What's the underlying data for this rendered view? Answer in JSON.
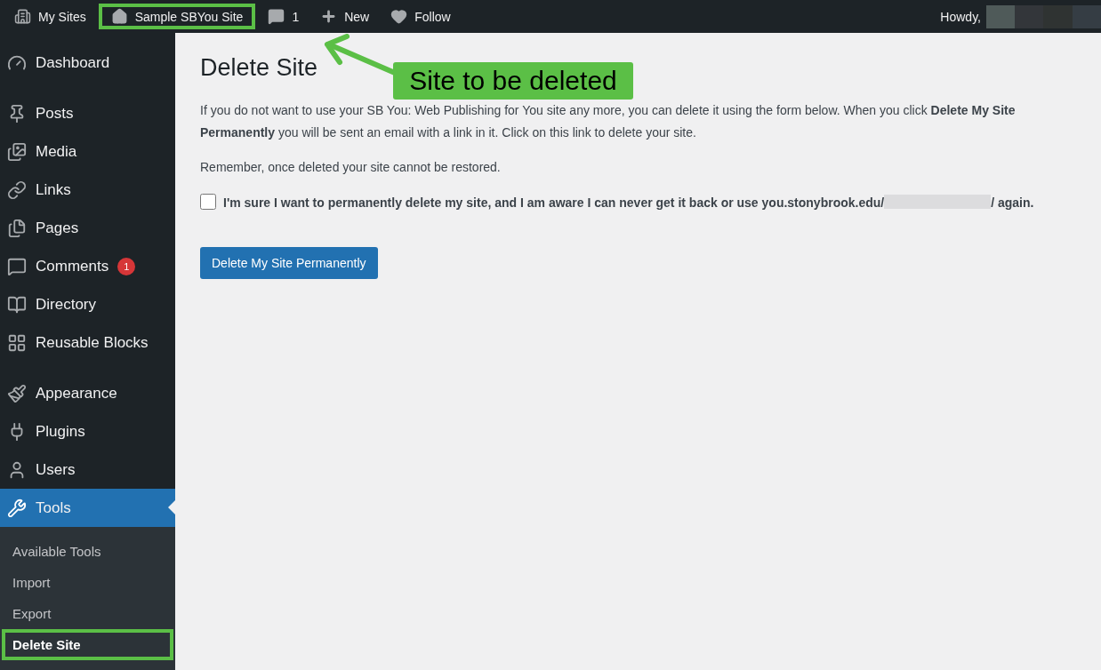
{
  "admin_bar": {
    "items": [
      {
        "kind": "sites",
        "label": "My Sites",
        "highlighted": false
      },
      {
        "kind": "home",
        "label": "Sample SBYou Site",
        "highlighted": true
      },
      {
        "kind": "comments",
        "label": "1",
        "highlighted": false
      },
      {
        "kind": "new",
        "label": "New",
        "highlighted": false
      },
      {
        "kind": "follow",
        "label": "Follow",
        "highlighted": false
      }
    ],
    "greeting": "Howdy,"
  },
  "sidebar": {
    "groups": [
      [
        {
          "label": "Dashboard",
          "selected": false
        }
      ],
      [
        {
          "label": "Posts",
          "selected": false
        },
        {
          "label": "Media",
          "selected": false
        },
        {
          "label": "Links",
          "selected": false
        },
        {
          "label": "Pages",
          "selected": false
        },
        {
          "label": "Comments",
          "selected": false,
          "badge": "1"
        },
        {
          "label": "Directory",
          "selected": false
        },
        {
          "label": "Reusable Blocks",
          "selected": false
        }
      ],
      [
        {
          "label": "Appearance",
          "selected": false
        },
        {
          "label": "Plugins",
          "selected": false
        },
        {
          "label": "Users",
          "selected": false
        },
        {
          "label": "Tools",
          "selected": true
        }
      ]
    ],
    "submenu": [
      {
        "label": "Available Tools",
        "selected": false,
        "highlighted": false
      },
      {
        "label": "Import",
        "selected": false,
        "highlighted": false
      },
      {
        "label": "Export",
        "selected": false,
        "highlighted": false
      },
      {
        "label": "Delete Site",
        "selected": true,
        "highlighted": true
      }
    ]
  },
  "main": {
    "title": "Delete Site",
    "paragraphs": [
      "If you do not want to use your SB You: Web Publishing for You site any more, you can delete it using the form below. When you click **Delete My Site Permanently** you will be sent an email with a link in it. Click on this link to delete your site.",
      "Remember, once deleted your site cannot be restored."
    ],
    "confirm": {
      "checked": false,
      "label_start": "I'm sure I want to permanently delete my site, and I am aware I can never get it back or use you.stonybrook.edu/",
      "label_end": "/ again."
    },
    "button": "Delete My Site Permanently"
  },
  "annotation": {
    "text": "Site to be deleted"
  }
}
